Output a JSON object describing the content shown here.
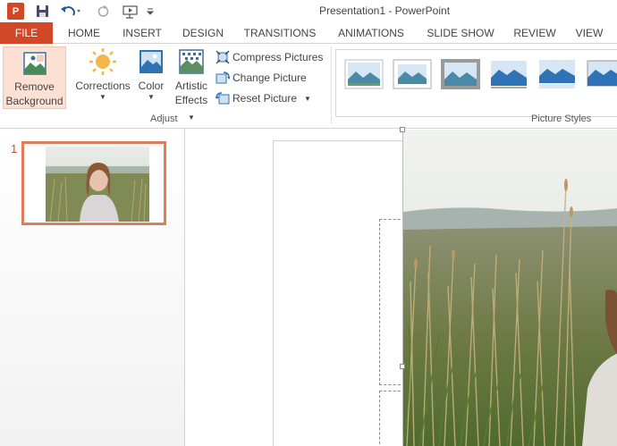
{
  "titlebar": {
    "app_icon": "P",
    "title": "Presentation1 - PowerPoint",
    "icons": [
      "powerpoint-app-icon",
      "save-icon",
      "undo-icon",
      "redo-icon",
      "start-from-beginning-icon",
      "customize-qat-icon"
    ]
  },
  "tabs": [
    {
      "label": "FILE"
    },
    {
      "label": "HOME"
    },
    {
      "label": "INSERT"
    },
    {
      "label": "DESIGN"
    },
    {
      "label": "TRANSITIONS"
    },
    {
      "label": "ANIMATIONS"
    },
    {
      "label": "SLIDE SHOW"
    },
    {
      "label": "REVIEW"
    },
    {
      "label": "VIEW"
    }
  ],
  "ribbon": {
    "remove_background": {
      "line1": "Remove",
      "line2": "Background"
    },
    "corrections": {
      "label": "Corrections"
    },
    "color": {
      "label": "Color"
    },
    "artistic_effects": {
      "line1": "Artistic",
      "line2": "Effects"
    },
    "compress": {
      "label": "Compress Pictures"
    },
    "change": {
      "label": "Change Picture"
    },
    "reset": {
      "label": "Reset Picture"
    },
    "adjust_group": "Adjust",
    "styles_group": "Picture Styles"
  },
  "slides": [
    {
      "number": "1"
    }
  ],
  "colors": {
    "accent": "#d24726",
    "selection": "#e07c59",
    "hover": "#fde0d4"
  }
}
